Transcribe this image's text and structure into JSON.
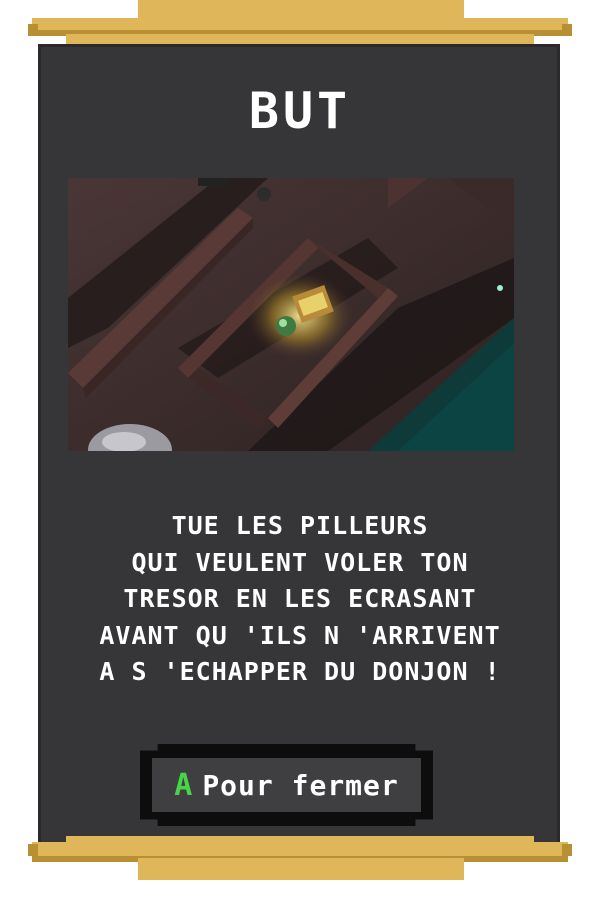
{
  "title": "BUT",
  "description_lines": [
    "Tue les pilleurs",
    "qui veulent voler ton",
    "tresor en les ecrasant",
    "avant qu 'ils n 'arrivent",
    "a s 'echapper du donjon !"
  ],
  "close_button": {
    "key": "A",
    "label": "Pour fermer"
  },
  "colors": {
    "panel": "#363639",
    "gold": "#dfb65a",
    "key": "#47d447"
  }
}
